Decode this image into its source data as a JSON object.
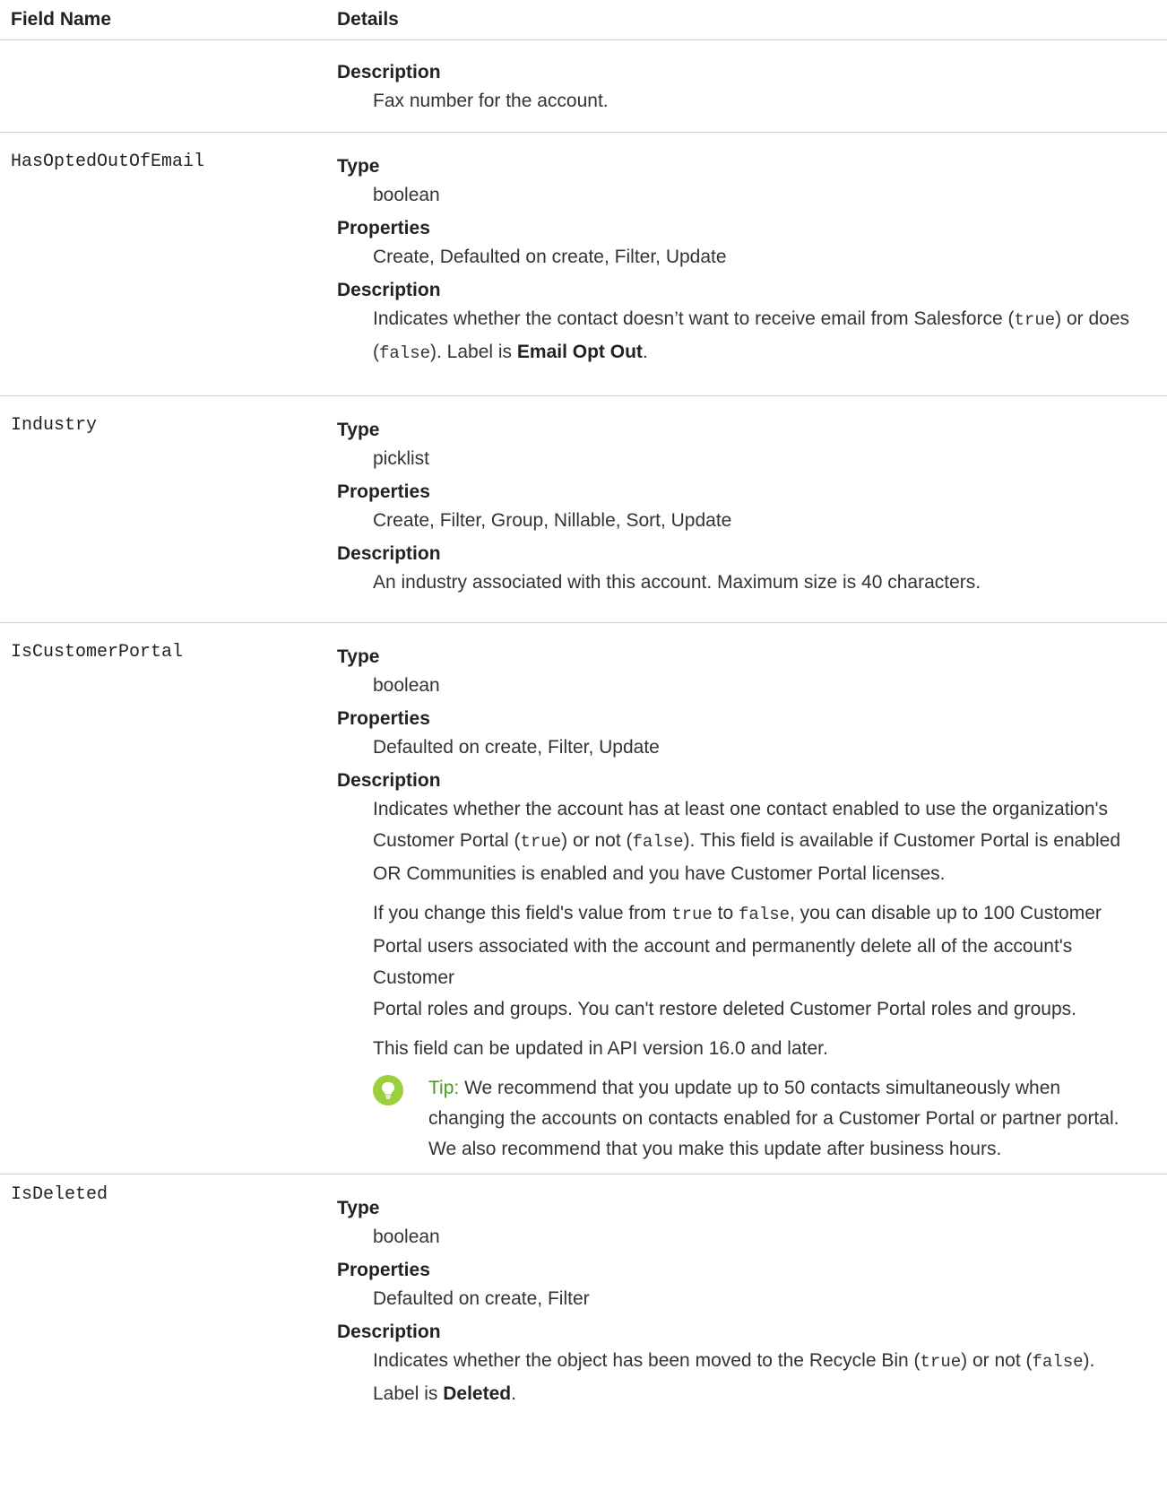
{
  "header": {
    "field_name": "Field Name",
    "details": "Details"
  },
  "rows": [
    {
      "description_label": "Description",
      "description": "Fax number for the account."
    },
    {
      "field": "HasOptedOutOfEmail",
      "type_label": "Type",
      "type": "boolean",
      "properties_label": "Properties",
      "properties": "Create, Defaulted on create, Filter, Update",
      "description_label": "Description",
      "desc_1": "Indicates whether the contact doesn’t want to receive email from Salesforce (",
      "desc_code_1": "true",
      "desc_2": ") or does",
      "desc_3": "(",
      "desc_code_2": "false",
      "desc_4": "). Label is ",
      "desc_bold": "Email Opt Out",
      "desc_5": "."
    },
    {
      "field": "Industry",
      "type_label": "Type",
      "type": "picklist",
      "properties_label": "Properties",
      "properties": "Create, Filter, Group, Nillable, Sort, Update",
      "description_label": "Description",
      "description": "An industry associated with this account. Maximum size is 40 characters."
    },
    {
      "field": "IsCustomerPortal",
      "type_label": "Type",
      "type": "boolean",
      "properties_label": "Properties",
      "properties": "Defaulted on create, Filter, Update",
      "description_label": "Description",
      "p1_line1_a": "Indicates whether the account has at least one contact enabled to use the organization's",
      "p1_line2_a": "Customer Portal (",
      "p1_code_true": "true",
      "p1_line2_b": ") or not (",
      "p1_code_false": "false",
      "p1_line2_c": "). This field is available if Customer Portal is enabled",
      "p1_line3": "OR Communities is enabled and you have Customer Portal licenses.",
      "p2_a": "If you change this field's value from ",
      "p2_code_true": "true",
      "p2_to": " to ",
      "p2_code_false": "false",
      "p2_b": ", you can disable up to 100 Customer",
      "p2_line2": "Portal users associated with the account and permanently delete all of the account's Customer",
      "p2_line3": "Portal roles and groups. You can't restore deleted Customer Portal roles and groups.",
      "p3": "This field can be updated in API version 16.0 and later.",
      "tip_label": "Tip:",
      "tip_line1": "We recommend that you update up to 50 contacts simultaneously when",
      "tip_line2": "changing the accounts on contacts enabled for a Customer Portal or partner portal.",
      "tip_line3": "We also recommend that you make this update after business hours."
    },
    {
      "field": "IsDeleted",
      "type_label": "Type",
      "type": "boolean",
      "properties_label": "Properties",
      "properties": "Defaulted on create, Filter",
      "description_label": "Description",
      "desc_1": "Indicates whether the object has been moved to the Recycle Bin (",
      "desc_code_1": "true",
      "desc_2": ") or not (",
      "desc_code_2": "false",
      "desc_3": ").",
      "desc_4": "Label is ",
      "desc_bold": "Deleted",
      "desc_5": "."
    }
  ],
  "icons": {
    "tip": "lightbulb-icon"
  },
  "colors": {
    "tip_icon": "#9bcf3e",
    "tip_label": "#4a9a1c",
    "divider": "#cfcfcf"
  }
}
